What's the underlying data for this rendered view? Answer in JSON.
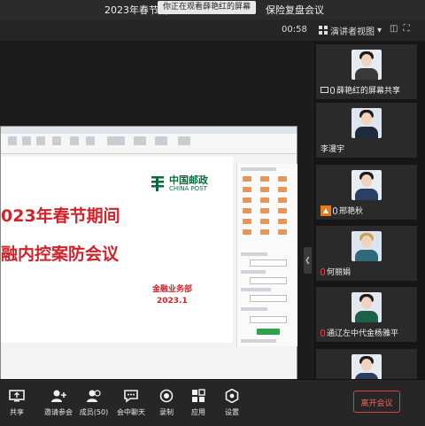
{
  "window": {
    "title": "2023年春节期",
    "title_tail": "保险复盘会议",
    "sharing_badge": "你正在观看薛艳红的屏幕"
  },
  "toolbar": {
    "timer": "00:58",
    "view_label": "演讲者视图"
  },
  "slide": {
    "logo_cn": "中国邮政",
    "logo_en": "CHINA POST",
    "title_line1": "023年春节期间",
    "title_line2": "融内控案防会议",
    "dept": "金融业务部",
    "date": "2023.1"
  },
  "participants": [
    {
      "name": "薛艳红的屏幕共享",
      "mic": "on",
      "role": "sharer"
    },
    {
      "name": "李漫宇",
      "mic": "none",
      "role": "member"
    },
    {
      "name": "邢艳秋",
      "mic": "on",
      "role": "host"
    },
    {
      "name": "何丽娟",
      "mic": "off",
      "role": "member"
    },
    {
      "name": "通辽左中代金杨雅平",
      "mic": "off",
      "role": "member"
    },
    {
      "name": "",
      "mic": "none",
      "role": "member"
    }
  ],
  "bottom_bar": {
    "items": [
      {
        "label": "共享",
        "icon": "share-screen-icon"
      },
      {
        "label": "邀请参会",
        "icon": "invite-icon"
      },
      {
        "label": "成员(50)",
        "icon": "members-icon"
      },
      {
        "label": "会中聊天",
        "icon": "chat-icon"
      },
      {
        "label": "录制",
        "icon": "record-icon"
      },
      {
        "label": "应用",
        "icon": "apps-icon"
      },
      {
        "label": "设置",
        "icon": "settings-icon"
      }
    ],
    "leave_label": "离开会议"
  },
  "colors": {
    "accent_red": "#d2232a",
    "china_post_green": "#0a6a3c",
    "leave_red": "#d9453a"
  }
}
